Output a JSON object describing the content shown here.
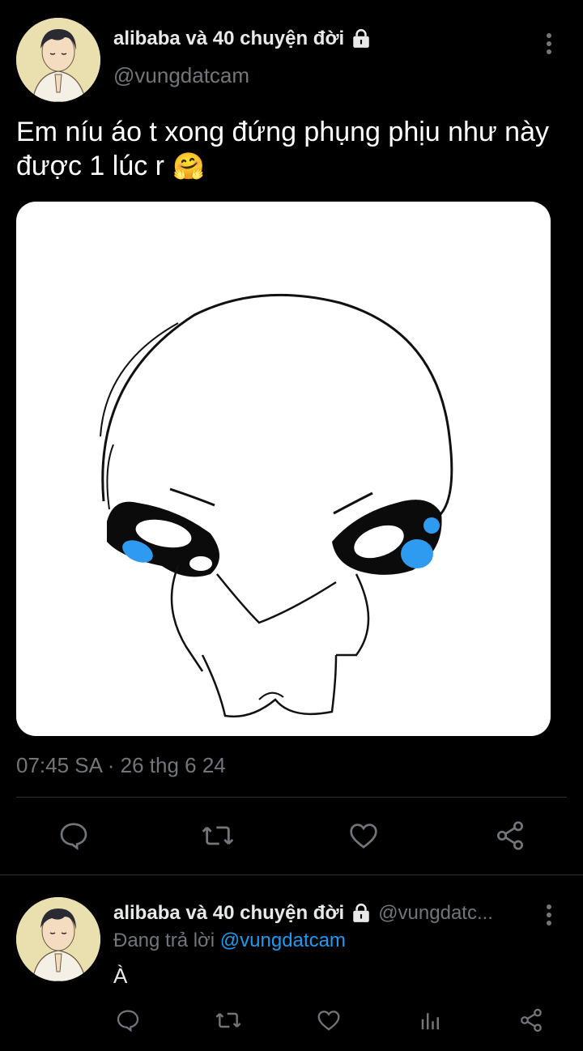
{
  "main_tweet": {
    "display_name": "alibaba và 40 chuyện đời",
    "handle": "@vungdatcam",
    "text_line1": "Em níu áo t xong đứng phụng phịu như này",
    "text_line2": "được 1 lúc r",
    "emoji": "🤗",
    "timestamp": "07:45 SA · 26 thg 6 24",
    "icons": {
      "lock": "lock-icon",
      "more": "more-vertical-icon",
      "reply": "reply-icon",
      "retweet": "retweet-icon",
      "like": "like-icon",
      "share": "share-icon"
    }
  },
  "reply_tweet": {
    "display_name": "alibaba và 40 chuyện đời",
    "handle": "@vungdatc...",
    "replying_prefix": "Đang trả lời",
    "replying_to": "@vungdatcam",
    "text": "À"
  },
  "colors": {
    "background": "#000000",
    "primary_text": "#e7e9ea",
    "secondary_text": "#71767b",
    "accent": "#1d9bf0",
    "divider": "#2f3336",
    "drawing_blue": "#2f9bf0"
  }
}
